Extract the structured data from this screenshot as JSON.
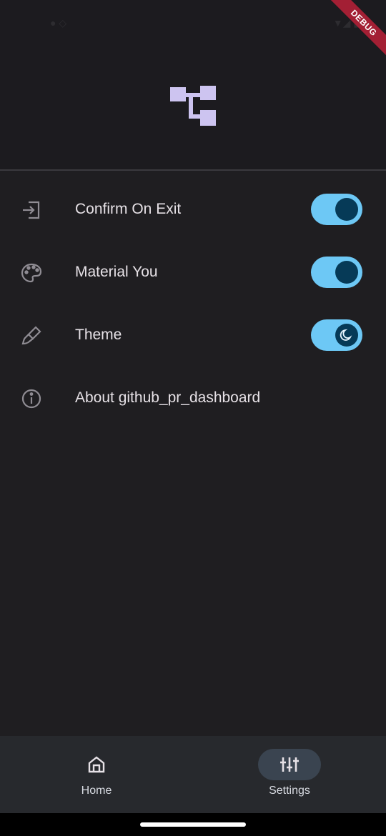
{
  "debug_banner": "DEBUG",
  "settings": [
    {
      "id": "confirm-on-exit",
      "label": "Confirm On Exit",
      "icon": "exit-icon",
      "toggle": true,
      "enabled": true
    },
    {
      "id": "material-you",
      "label": "Material You",
      "icon": "palette-icon",
      "toggle": true,
      "enabled": true
    },
    {
      "id": "theme",
      "label": "Theme",
      "icon": "paintbrush-icon",
      "toggle": true,
      "enabled": true,
      "thumb_icon": "moon-icon"
    },
    {
      "id": "about",
      "label": "About github_pr_dashboard",
      "icon": "info-icon",
      "toggle": false
    }
  ],
  "bottom_nav": {
    "items": [
      {
        "label": "Home",
        "icon": "home-icon",
        "active": false
      },
      {
        "label": "Settings",
        "icon": "sliders-icon",
        "active": true
      }
    ]
  },
  "colors": {
    "background": "#1f1e21",
    "header": "#1c1b1f",
    "switch_track": "#6dc8f5",
    "switch_thumb": "#063a57",
    "logo": "#cdc4f0",
    "nav_bar": "#27292d",
    "nav_active_pill": "#3a4450",
    "debug_ribbon": "#a31f34"
  }
}
